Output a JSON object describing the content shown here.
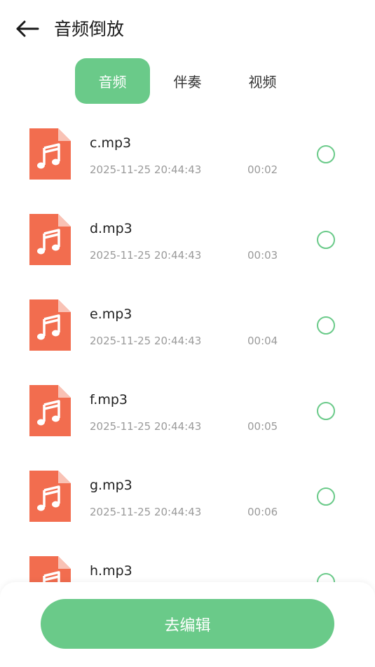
{
  "header": {
    "title": "音频倒放",
    "back_icon": "arrow-left-icon"
  },
  "tabs": [
    {
      "label": "音频",
      "active": true
    },
    {
      "label": "伴奏",
      "active": false
    },
    {
      "label": "视频",
      "active": false
    }
  ],
  "files": [
    {
      "name": "c.mp3",
      "date": "2025-11-25 20:44:43",
      "duration": "00:02"
    },
    {
      "name": "d.mp3",
      "date": "2025-11-25 20:44:43",
      "duration": "00:03"
    },
    {
      "name": "e.mp3",
      "date": "2025-11-25 20:44:43",
      "duration": "00:04"
    },
    {
      "name": "f.mp3",
      "date": "2025-11-25 20:44:43",
      "duration": "00:05"
    },
    {
      "name": "g.mp3",
      "date": "2025-11-25 20:44:43",
      "duration": "00:06"
    },
    {
      "name": "h.mp3",
      "date": "",
      "duration": ""
    }
  ],
  "footer": {
    "edit_label": "去编辑"
  },
  "colors": {
    "accent": "#6aca89",
    "file_icon": "#f26d4f",
    "file_icon_fold": "#f9c2b5"
  }
}
